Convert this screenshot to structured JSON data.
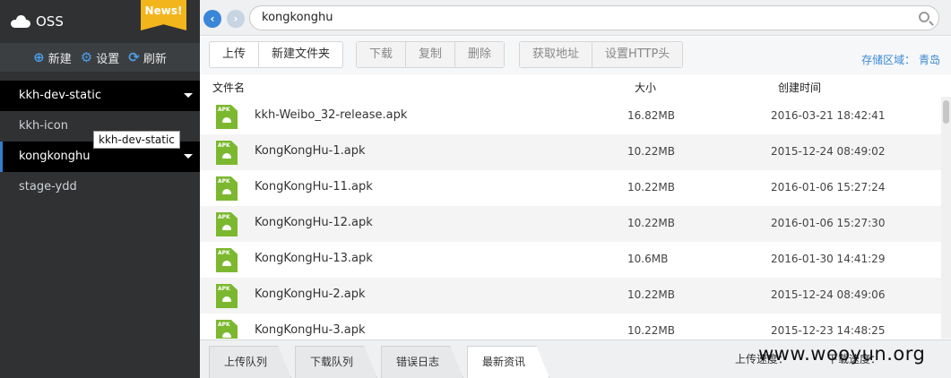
{
  "app": {
    "title": "OSS",
    "badge": "News!"
  },
  "sidebar": {
    "toolbar": [
      {
        "icon": "plus-circle-icon",
        "glyph": "⊕",
        "label": "新建"
      },
      {
        "icon": "gear-icon",
        "glyph": "⚙",
        "label": "设置"
      },
      {
        "icon": "refresh-icon",
        "glyph": "⟳",
        "label": "刷新"
      }
    ],
    "buckets": [
      {
        "label": "kkh-dev-static",
        "state": "dark"
      },
      {
        "label": "kkh-icon",
        "state": "normal"
      },
      {
        "label": "kongkonghu",
        "state": "active"
      },
      {
        "label": "stage-ydd",
        "state": "normal"
      }
    ],
    "tooltip": "kkh-dev-static"
  },
  "address": {
    "path": "kongkonghu"
  },
  "toolbar": {
    "upload": "上传",
    "new_folder": "新建文件夹",
    "download": "下载",
    "copy": "复制",
    "delete": "删除",
    "get_address": "获取地址",
    "set_http_header": "设置HTTP头",
    "region": "存储区域： 青岛"
  },
  "table": {
    "headers": {
      "name": "文件名",
      "size": "大小",
      "created": "创建时间"
    },
    "rows": [
      {
        "name": "kkh-Weibo_32-release.apk",
        "size": "16.82MB",
        "created": "2016-03-21 18:42:41"
      },
      {
        "name": "KongKongHu-1.apk",
        "size": "10.22MB",
        "created": "2015-12-24 08:49:02"
      },
      {
        "name": "KongKongHu-11.apk",
        "size": "10.22MB",
        "created": "2016-01-06 15:27:24"
      },
      {
        "name": "KongKongHu-12.apk",
        "size": "10.22MB",
        "created": "2016-01-06 15:27:30"
      },
      {
        "name": "KongKongHu-13.apk",
        "size": "10.6MB",
        "created": "2016-01-30 14:41:29"
      },
      {
        "name": "KongKongHu-2.apk",
        "size": "10.22MB",
        "created": "2015-12-24 08:49:06"
      },
      {
        "name": "KongKongHu-3.apk",
        "size": "10.22MB",
        "created": "2015-12-23 14:48:25"
      }
    ]
  },
  "bottom": {
    "tabs": [
      "上传队列",
      "下载队列",
      "错误日志",
      "最新资讯"
    ],
    "active_tab": 3,
    "upload_speed": "上传速度：",
    "download_speed": "下载速度："
  },
  "watermark": "www.wooyun.org"
}
